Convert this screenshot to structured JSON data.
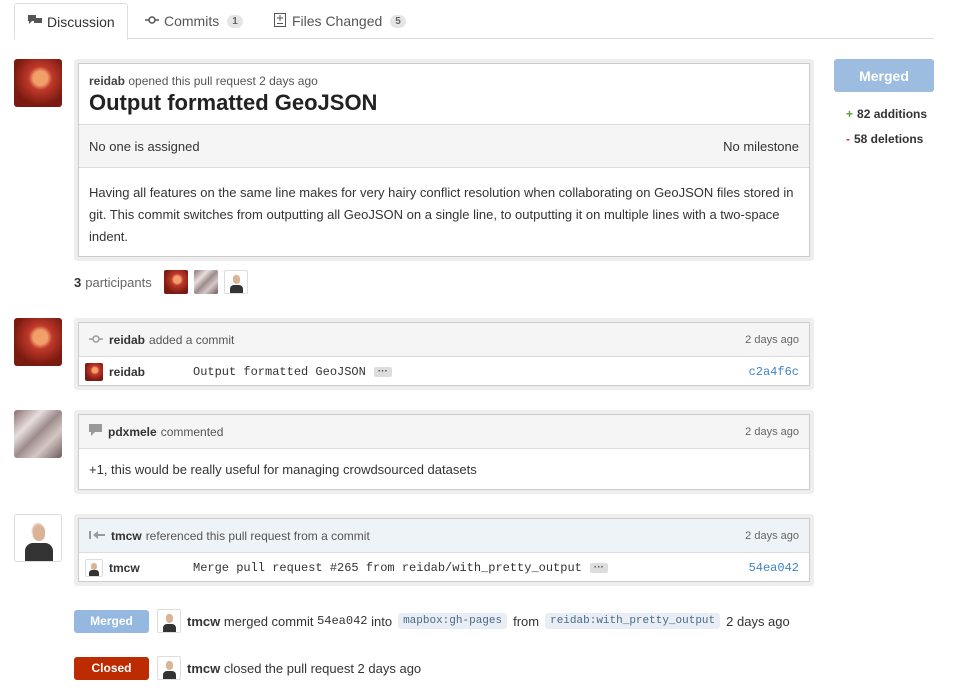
{
  "tabs": [
    {
      "label": "Discussion",
      "icon": "discussion-icon"
    },
    {
      "label": "Commits",
      "icon": "commit-icon",
      "count": "1"
    },
    {
      "label": "Files Changed",
      "icon": "diff-icon",
      "count": "5"
    }
  ],
  "pr": {
    "author": "reidab",
    "opened_text": "opened this pull request 2 days ago",
    "title": "Output formatted GeoJSON",
    "assignee": "No one is assigned",
    "milestone": "No milestone",
    "body": "Having all features on the same line makes for very hairy conflict resolution when collaborating on GeoJSON files stored in git. This commit switches from outputting all GeoJSON on a single line, to outputting it on multiple lines with a two-space indent."
  },
  "participants": {
    "count": "3",
    "label": "participants"
  },
  "sidebar": {
    "status": "Merged",
    "additions": "82 additions",
    "deletions": "58 deletions",
    "plus": "+",
    "minus": "-"
  },
  "timeline": {
    "commit_event": {
      "author": "reidab",
      "action": "added a commit",
      "time": "2 days ago",
      "row_author": "reidab",
      "message": "Output formatted GeoJSON",
      "sha": "c2a4f6c"
    },
    "comment": {
      "author": "pdxmele",
      "action": "commented",
      "time": "2 days ago",
      "body": "+1, this would be really useful for managing crowdsourced datasets"
    },
    "reference": {
      "author": "tmcw",
      "action": "referenced this pull request from a commit",
      "time": "2 days ago",
      "row_author": "tmcw",
      "message": "Merge pull request #265 from reidab/with_pretty_output",
      "sha": "54ea042"
    },
    "merge_event": {
      "badge": "Merged",
      "author": "tmcw",
      "action": "merged commit",
      "sha": "54ea042",
      "into": "into",
      "base": "mapbox:gh-pages",
      "from": "from",
      "head": "reidab:with_pretty_output",
      "time": "2 days ago"
    },
    "close_event": {
      "badge": "Closed",
      "author": "tmcw",
      "action": "closed the pull request 2 days ago"
    }
  },
  "ellipsis": "···"
}
